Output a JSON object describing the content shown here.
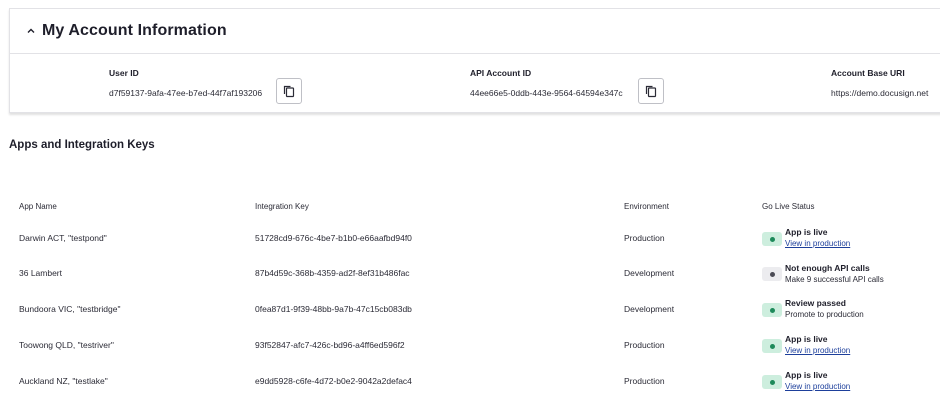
{
  "account": {
    "title": "My Account Information",
    "fields": [
      {
        "label": "User ID",
        "value": "d7f59137-9afa-47ee-b7ed-44f7af193206"
      },
      {
        "label": "API Account ID",
        "value": "44ee66e5-0ddb-443e-9564-64594e347c"
      },
      {
        "label": "Account Base URI",
        "value": "https://demo.docusign.net"
      }
    ]
  },
  "apps": {
    "title": "Apps and Integration Keys",
    "columns": [
      "App Name",
      "Integration Key",
      "Environment",
      "Go Live Status"
    ],
    "rows": [
      {
        "name": "Darwin ACT, \"testpond\"",
        "key": "51728cd9-676c-4be7-b1b0-e66aafbd94f0",
        "env": "Production",
        "status": "App is live",
        "detail": "View in production",
        "detail_is_link": true,
        "state": "live"
      },
      {
        "name": "36 Lambert",
        "key": "87b4d59c-368b-4359-ad2f-8ef31b486fac",
        "env": "Development",
        "status": "Not enough API calls",
        "detail": "Make 9 successful API calls",
        "detail_is_link": false,
        "state": "pending"
      },
      {
        "name": "Bundoora VIC, \"testbridge\"",
        "key": "0fea87d1-9f39-48bb-9a7b-47c15cb083db",
        "env": "Development",
        "status": "Review passed",
        "detail": "Promote to production",
        "detail_is_link": false,
        "state": "live"
      },
      {
        "name": "Toowong QLD, \"testriver\"",
        "key": "93f52847-afc7-426c-bd96-a4ff6ed596f2",
        "env": "Production",
        "status": "App is live",
        "detail": "View in production",
        "detail_is_link": true,
        "state": "live"
      },
      {
        "name": "Auckland NZ, \"testlake\"",
        "key": "e9dd5928-c6fe-4d72-b0e2-9042a2defac4",
        "env": "Production",
        "status": "App is live",
        "detail": "View in production",
        "detail_is_link": true,
        "state": "live"
      }
    ]
  },
  "colors": {
    "live": "#1d8a5a",
    "link": "#1d3f9b"
  },
  "icons": {
    "collapse": "chevron-up-icon",
    "copy": "copy-icon",
    "status": "status-dot-icon"
  }
}
